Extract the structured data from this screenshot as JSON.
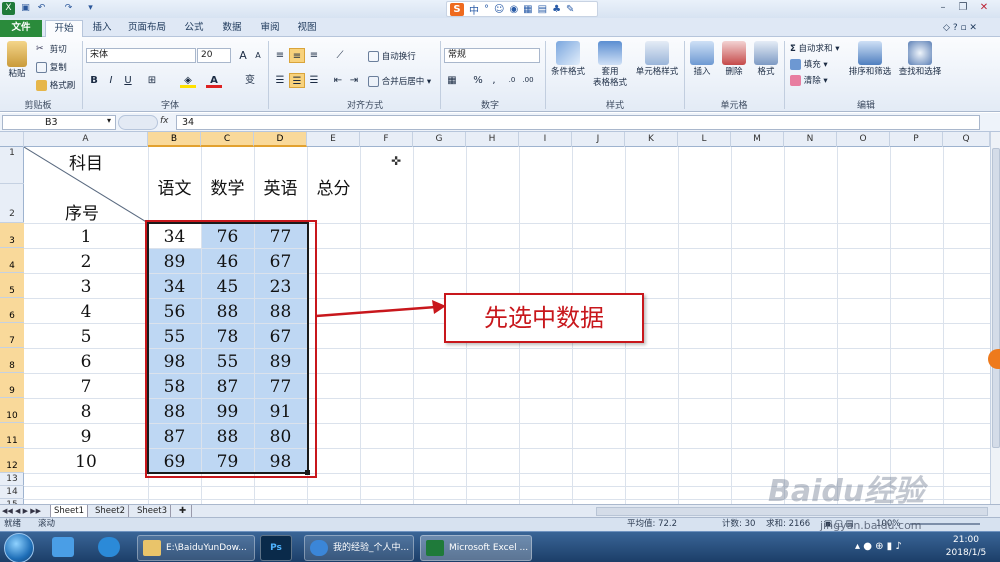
{
  "app": {
    "name": "Microsoft Excel"
  },
  "tabs": [
    "文件",
    "开始",
    "插入",
    "页面布局",
    "公式",
    "数据",
    "审阅",
    "视图"
  ],
  "ribbon": {
    "clipboard": {
      "paste": "粘贴",
      "cut": "剪切",
      "copy": "复制",
      "format_painter": "格式刷",
      "label": "剪贴板"
    },
    "font": {
      "name": "宋体",
      "size": "20",
      "label": "字体",
      "bold": "B",
      "italic": "I",
      "underline": "U",
      "grow": "A",
      "shrink": "A",
      "wen": "变"
    },
    "alignment": {
      "wrap": "自动换行",
      "merge": "合并后居中",
      "label": "对齐方式"
    },
    "number": {
      "format": "常规",
      "percent": "%",
      "comma": ",",
      "label": "数字"
    },
    "styles": {
      "conditional": "条件格式",
      "table_format_1": "套用",
      "table_format_2": "表格格式",
      "cell_styles": "单元格样式",
      "label": "样式"
    },
    "cells": {
      "insert": "插入",
      "delete": "删除",
      "format": "格式",
      "label": "单元格"
    },
    "editing": {
      "autosum": "自动求和",
      "fill": "填充",
      "clear": "清除",
      "sort_filter": "排序和筛选",
      "find_select": "查找和选择",
      "label": "编辑"
    }
  },
  "formula_bar": {
    "name_box": "B3",
    "fx": "fx",
    "value": "34"
  },
  "columns": [
    "A",
    "B",
    "C",
    "D",
    "E",
    "F",
    "G",
    "H",
    "I",
    "J",
    "K",
    "L",
    "M",
    "N",
    "O",
    "P",
    "Q"
  ],
  "rows": [
    "1",
    "2",
    "3",
    "4",
    "5",
    "6",
    "7",
    "8",
    "9",
    "10",
    "11",
    "12",
    "13",
    "14",
    "15"
  ],
  "header_cells": {
    "subject": "科目",
    "seq": "序号",
    "b": "语文",
    "c": "数学",
    "d": "英语",
    "e": "总分"
  },
  "data_rows": [
    {
      "no": "1",
      "b": "34",
      "c": "76",
      "d": "77"
    },
    {
      "no": "2",
      "b": "89",
      "c": "46",
      "d": "67"
    },
    {
      "no": "3",
      "b": "34",
      "c": "45",
      "d": "23"
    },
    {
      "no": "4",
      "b": "56",
      "c": "88",
      "d": "88"
    },
    {
      "no": "5",
      "b": "55",
      "c": "78",
      "d": "67"
    },
    {
      "no": "6",
      "b": "98",
      "c": "55",
      "d": "89"
    },
    {
      "no": "7",
      "b": "58",
      "c": "87",
      "d": "77"
    },
    {
      "no": "8",
      "b": "88",
      "c": "99",
      "d": "91"
    },
    {
      "no": "9",
      "b": "87",
      "c": "88",
      "d": "80"
    },
    {
      "no": "10",
      "b": "69",
      "c": "79",
      "d": "98"
    }
  ],
  "callout": "先选中数据",
  "sheets": [
    "Sheet1",
    "Sheet2",
    "Sheet3"
  ],
  "status": {
    "ready": "就绪",
    "scroll": "滚动",
    "average": "平均值: 72.2",
    "count": "计数: 30",
    "sum_partial": "求和: 2166",
    "zoom": "100%"
  },
  "taskbar": {
    "items": [
      "E:\\BaiduYunDow...",
      "Ps",
      "我的经验_个人中...",
      "Microsoft Excel ..."
    ],
    "time": "21:00",
    "date": "2018/1/5"
  },
  "watermark": {
    "brand": "Baidu经验",
    "url": "jingyan.baidu.com"
  },
  "colors": {
    "accent": "#2a8b3b",
    "selection": "#bed7f3",
    "callout_red": "#c8171c",
    "header_sel": "#f9d99a"
  }
}
